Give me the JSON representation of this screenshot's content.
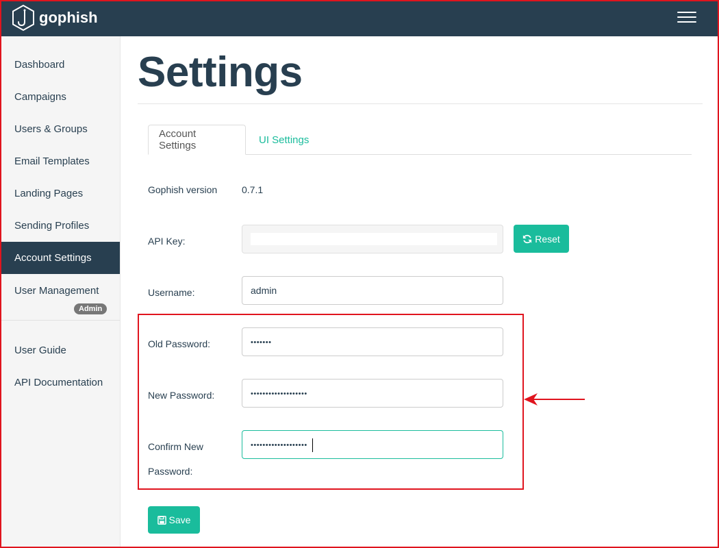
{
  "app": {
    "brand": "gophish"
  },
  "sidebar": {
    "items": [
      {
        "label": "Dashboard"
      },
      {
        "label": "Campaigns"
      },
      {
        "label": "Users & Groups"
      },
      {
        "label": "Email Templates"
      },
      {
        "label": "Landing Pages"
      },
      {
        "label": "Sending Profiles"
      },
      {
        "label": "Account Settings",
        "active": true
      },
      {
        "label": "User Management",
        "badge": "Admin"
      },
      {
        "label": "User Guide"
      },
      {
        "label": "API Documentation"
      }
    ]
  },
  "main": {
    "title": "Settings",
    "tabs": [
      {
        "label": "Account Settings",
        "active": true
      },
      {
        "label": "UI Settings"
      }
    ],
    "version": {
      "label": "Gophish version",
      "value": "0.7.1"
    },
    "api_key": {
      "label": "API Key:",
      "value": "",
      "reset_label": "Reset"
    },
    "username": {
      "label": "Username:",
      "value": "admin"
    },
    "old_password": {
      "label": "Old Password:",
      "masked": "•••••••"
    },
    "new_password": {
      "label": "New Password:",
      "masked": "•••••••••••••••••••"
    },
    "confirm_password": {
      "label_line1": "Confirm New",
      "label_line2": "Password:",
      "masked": "•••••••••••••••••••"
    },
    "save_label": "Save"
  },
  "colors": {
    "navbar": "#283f50",
    "accent": "#1abc9c",
    "annotation": "#e0141e",
    "sidebar_bg": "#f5f5f5"
  }
}
